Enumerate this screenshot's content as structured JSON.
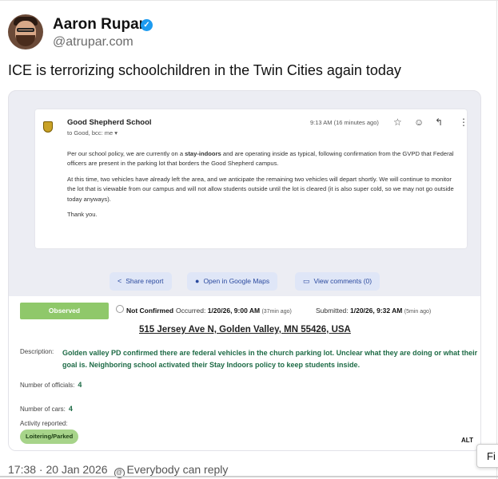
{
  "post": {
    "author_name": "Aaron Rupar",
    "verified_mark": "✓",
    "handle": "@atrupar.com",
    "text": "ICE is terrorizing schoolchildren in the Twin Cities again today",
    "timestamp": "17:38 · 20 Jan 2026",
    "reply_setting": "Everybody can reply",
    "alt_badge": "ALT",
    "popup_text": "Fi"
  },
  "email": {
    "sender": "Good Shepherd School",
    "recipients": "to Good, bcc: me",
    "time": "9:13 AM (16 minutes ago)",
    "paragraph1_before": "Per our school policy, we are currently on a ",
    "paragraph1_bold": "stay-indoors",
    "paragraph1_after": " and are operating inside as typical, following confirmation from the GVPD that Federal officers are present in the parking lot that borders the Good Shepherd campus.",
    "paragraph2": "At this time, two vehicles have already left the area, and we anticipate the remaining two vehicles will depart shortly. We will continue to monitor the lot that is viewable from our campus and will not allow students outside until the lot is cleared (it is also super cold, so we may not go outside today anyways).",
    "paragraph3": "Thank you."
  },
  "actions": {
    "share": "Share report",
    "maps": "Open in Google Maps",
    "comments": "View comments (0)"
  },
  "report": {
    "status": "Observed",
    "confirmation": "Not Confirmed",
    "occurred_label": "Occurred:",
    "occurred_value": "1/20/26, 9:00 AM",
    "occurred_ago": "(37min ago)",
    "submitted_label": "Submitted:",
    "submitted_value": "1/20/26, 9:32 AM",
    "submitted_ago": "(5min ago)",
    "address": "515 Jersey Ave N, Golden Valley, MN 55426, USA",
    "description_label": "Description:",
    "description": "Golden valley PD confirmed there are federal vehicles in the church parking lot. Unclear what they are doing or what their goal is. Neighboring school activated their Stay Indoors policy to keep students inside.",
    "officials_label": "Number of officials:",
    "officials_value": "4",
    "cars_label": "Number of cars:",
    "cars_value": "4",
    "activity_label": "Activity reported:",
    "activity_value": "Loitering/Parked"
  },
  "colors": {
    "observed": "#8fc86a",
    "accent_green_text": "#1e6b46",
    "button_bg": "#dfe6f7",
    "verified": "#1d9bf0"
  }
}
